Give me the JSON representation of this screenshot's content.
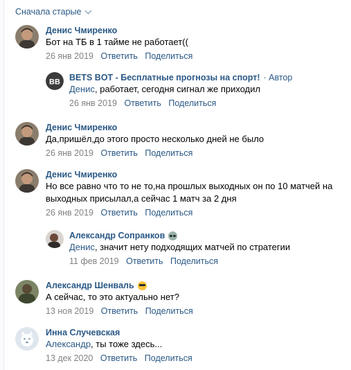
{
  "sort": {
    "label": "Сначала старые"
  },
  "comments": [
    {
      "author": "Денис Чмиренко",
      "text": "Бот на ТБ в 1 тайме не работает((",
      "date": "26 янв 2019",
      "reply_label": "Ответить",
      "share_label": "Поделиться"
    },
    {
      "author": "BETS BOT - Бесплатные прогнозы на спорт!",
      "author_suffix": "· Автор",
      "avatar_text": "BB",
      "reply_to": "Денис",
      "text": ", работает, сегодня сигнал же приходил",
      "date": "26 янв 2019",
      "reply_label": "Ответить",
      "share_label": "Поделиться"
    },
    {
      "author": "Денис Чмиренко",
      "text": "Да,пришёл,до этого просто несколько дней не было",
      "date": "26 янв 2019",
      "reply_label": "Ответить",
      "share_label": "Поделиться"
    },
    {
      "author": "Денис Чмиренко",
      "text": "Но все равно что то не то,на прошлых выходных он по 10 матчей на\nвыходных присылал,а сейчас 1 матч за 2 дня",
      "date": "26 янв 2019",
      "reply_label": "Ответить",
      "share_label": "Поделиться"
    },
    {
      "author": "Александр Сопранков",
      "author_emoji": "alien-icon",
      "reply_to": "Денис",
      "text": ", значит нету подходящих матчей по стратегии",
      "date": "11 фев 2019",
      "reply_label": "Ответить",
      "share_label": "Поделиться"
    },
    {
      "author": "Александр Шенваль",
      "author_emoji": "sunglasses-icon",
      "text": "А сейчас, то это актуально нет?",
      "date": "13 ноя 2019",
      "reply_label": "Ответить",
      "share_label": "Поделиться"
    },
    {
      "author": "Инна Случевская",
      "reply_to": "Александр",
      "text": ", ты тоже здесь...",
      "date": "13 дек 2020",
      "reply_label": "Ответить",
      "share_label": "Поделиться"
    }
  ],
  "colors": {
    "link": "#2a5885",
    "meta": "#828282",
    "text": "#000000"
  }
}
